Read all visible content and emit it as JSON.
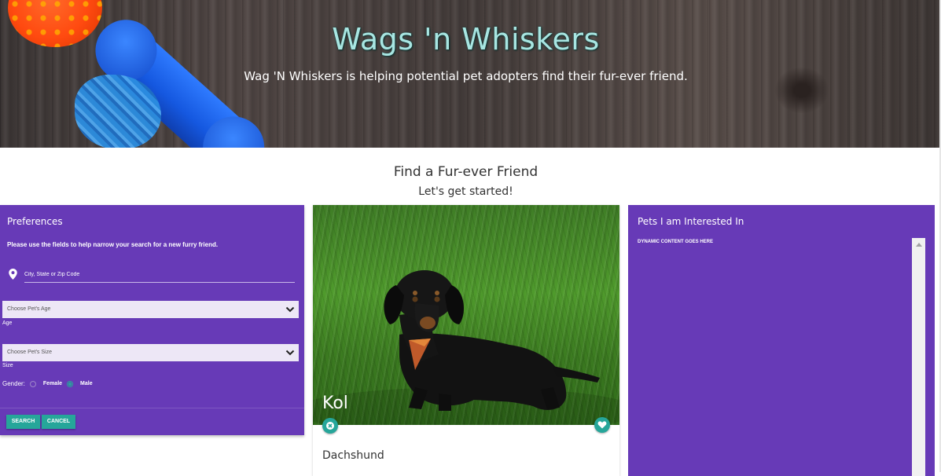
{
  "hero": {
    "title": "Wags 'n Whiskers",
    "subtitle": "Wag 'N Whiskers is helping potential pet adopters find their fur-ever friend."
  },
  "section": {
    "title": "Find a Fur-ever Friend",
    "subtitle": "Let's get started!"
  },
  "preferences": {
    "title": "Preferences",
    "description": "Please use the fields to help narrow your search for a new furry friend.",
    "location_placeholder": "City, State or Zip Code",
    "age_select": "Choose Pet's Age",
    "age_label": "Age",
    "size_select": "Choose Pet's Size",
    "size_label": "Size",
    "gender_label": "Gender:",
    "gender_options": [
      "Female",
      "Male"
    ],
    "gender_selected": "Male",
    "search_button": "Search",
    "cancel_button": "Cancel"
  },
  "pet": {
    "name": "Kol",
    "breed": "Dachshund"
  },
  "interested": {
    "title": "Pets I am Interested In",
    "content": "DYNAMIC CONTENT GOES HERE"
  },
  "colors": {
    "primary_purple": "#673ab7",
    "teal_accent": "#26a69a",
    "hero_title": "#a8e6e2"
  },
  "icons": [
    "location-pin-icon",
    "chevron-down-icon",
    "close-icon",
    "heart-icon"
  ]
}
